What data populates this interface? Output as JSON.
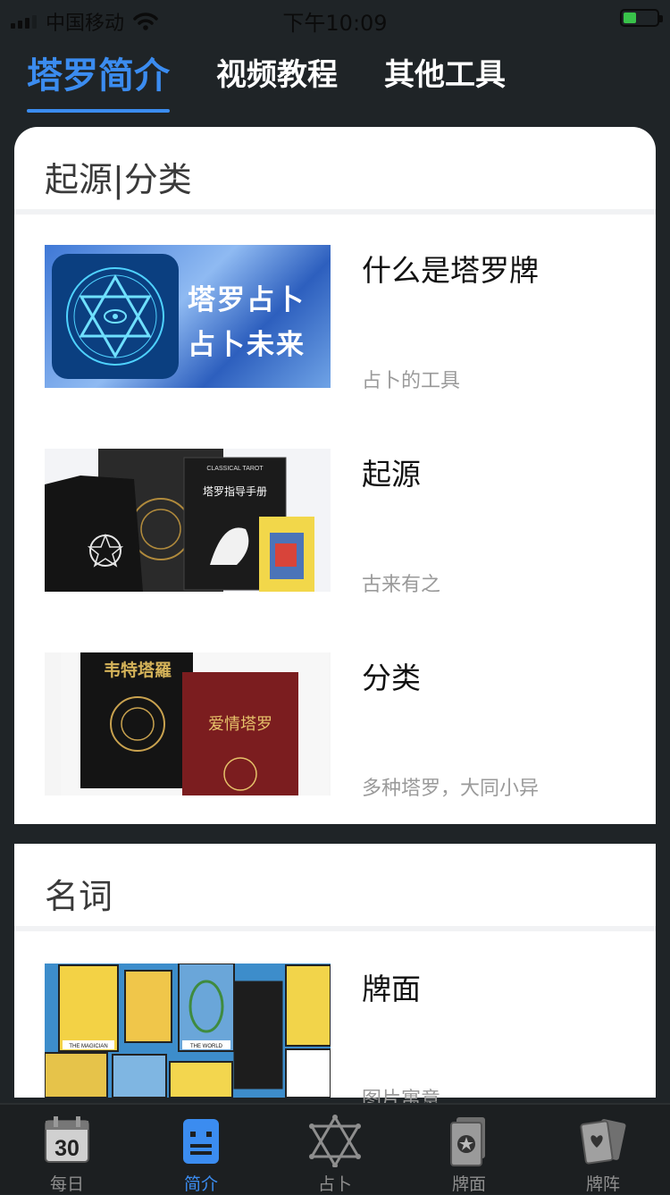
{
  "status_bar": {
    "carrier": "中国移动",
    "time": "下午10:09"
  },
  "tabs": [
    {
      "label": "塔罗简介",
      "active": true
    },
    {
      "label": "视频教程",
      "active": false
    },
    {
      "label": "其他工具",
      "active": false
    }
  ],
  "sections": [
    {
      "title": "起源|分类",
      "items": [
        {
          "title": "什么是塔罗牌",
          "subtitle": "占卜的工具",
          "image_text": [
            "塔罗占卜",
            "占卜未来"
          ]
        },
        {
          "title": "起源",
          "subtitle": "古来有之",
          "image_text": [
            "CLASSICAL TAROT",
            "塔罗指导手册"
          ]
        },
        {
          "title": "分类",
          "subtitle": "多种塔罗，大同小异",
          "image_text": [
            "韦特塔羅",
            "爱情塔罗"
          ]
        }
      ]
    },
    {
      "title": "名词",
      "items": [
        {
          "title": "牌面",
          "subtitle": "图片寓意",
          "image_text": [
            "THE MAGICIAN",
            "THE WORLD"
          ]
        }
      ]
    }
  ],
  "bottom_nav": [
    {
      "label": "每日",
      "icon": "calendar-icon",
      "icon_text": "30",
      "active": false
    },
    {
      "label": "简介",
      "icon": "document-icon",
      "active": true
    },
    {
      "label": "占卜",
      "icon": "hexagram-icon",
      "active": false
    },
    {
      "label": "牌面",
      "icon": "card-icon",
      "active": false
    },
    {
      "label": "牌阵",
      "icon": "cards-spread-icon",
      "active": false
    }
  ],
  "colors": {
    "accent": "#3b8cf0",
    "background": "#1f2427",
    "inactive": "#8e8e8e"
  }
}
